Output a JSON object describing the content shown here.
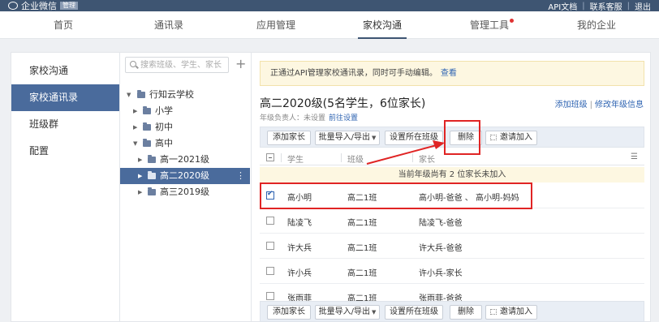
{
  "topbar": {
    "logo_text": "企业微信",
    "logo_badge": "管理",
    "links": [
      "API文档",
      "联系客服",
      "退出"
    ]
  },
  "nav": {
    "items": [
      "首页",
      "通讯录",
      "应用管理",
      "家校沟通",
      "管理工具",
      "我的企业"
    ],
    "active": "家校沟通"
  },
  "sidebar": {
    "items": [
      "家校沟通",
      "家校通讯录",
      "班级群",
      "配置"
    ],
    "active": "家校通讯录"
  },
  "tree": {
    "search_placeholder": "搜索班级、学生、家长",
    "root": "行知云学校",
    "nodes": [
      "小学",
      "初中",
      "高中",
      "高一2021级",
      "高二2020级",
      "高三2019级"
    ],
    "selected": "高二2020级",
    "more_glyph": "⋮"
  },
  "main": {
    "notice_text": "正通过API管理家校通讯录，同时可手动编辑。",
    "notice_link": "查看",
    "title": "高二2020级(5名学生，6位家长)",
    "title_links": [
      "添加班级",
      "修改年级信息"
    ],
    "title_link_sep": "|",
    "subline_text": "年级负责人：未设置",
    "subline_link": "前往设置",
    "toolbar": {
      "add_parent": "添加家长",
      "batch": "批量导入/导出",
      "set_class": "设置所在班级",
      "delete": "删除",
      "invite": "邀请加入"
    },
    "columns": [
      "学生",
      "班级",
      "家长"
    ],
    "menu_glyph": "☰",
    "group_banner": "当前年级尚有 2 位家长未加入",
    "rows": [
      {
        "student": "高小明",
        "class": "高二1班",
        "parents": "高小明-爸爸 、 高小明-妈妈",
        "checked": true
      },
      {
        "student": "陆凌飞",
        "class": "高二1班",
        "parents": "陆凌飞-爸爸",
        "checked": false
      },
      {
        "student": "许大兵",
        "class": "高二1班",
        "parents": "许大兵-爸爸",
        "checked": false
      },
      {
        "student": "许小兵",
        "class": "高二1班",
        "parents": "许小兵-家长",
        "checked": false
      },
      {
        "student": "张雨菲",
        "class": "高二1班",
        "parents": "张雨菲-爸爸",
        "checked": false
      }
    ]
  },
  "colors": {
    "topbar": "#3e5572",
    "sidebar_active": "#4a6b9c",
    "link": "#2f64b2",
    "notice_bg": "#fdf7e1",
    "annotation": "#e02424"
  }
}
